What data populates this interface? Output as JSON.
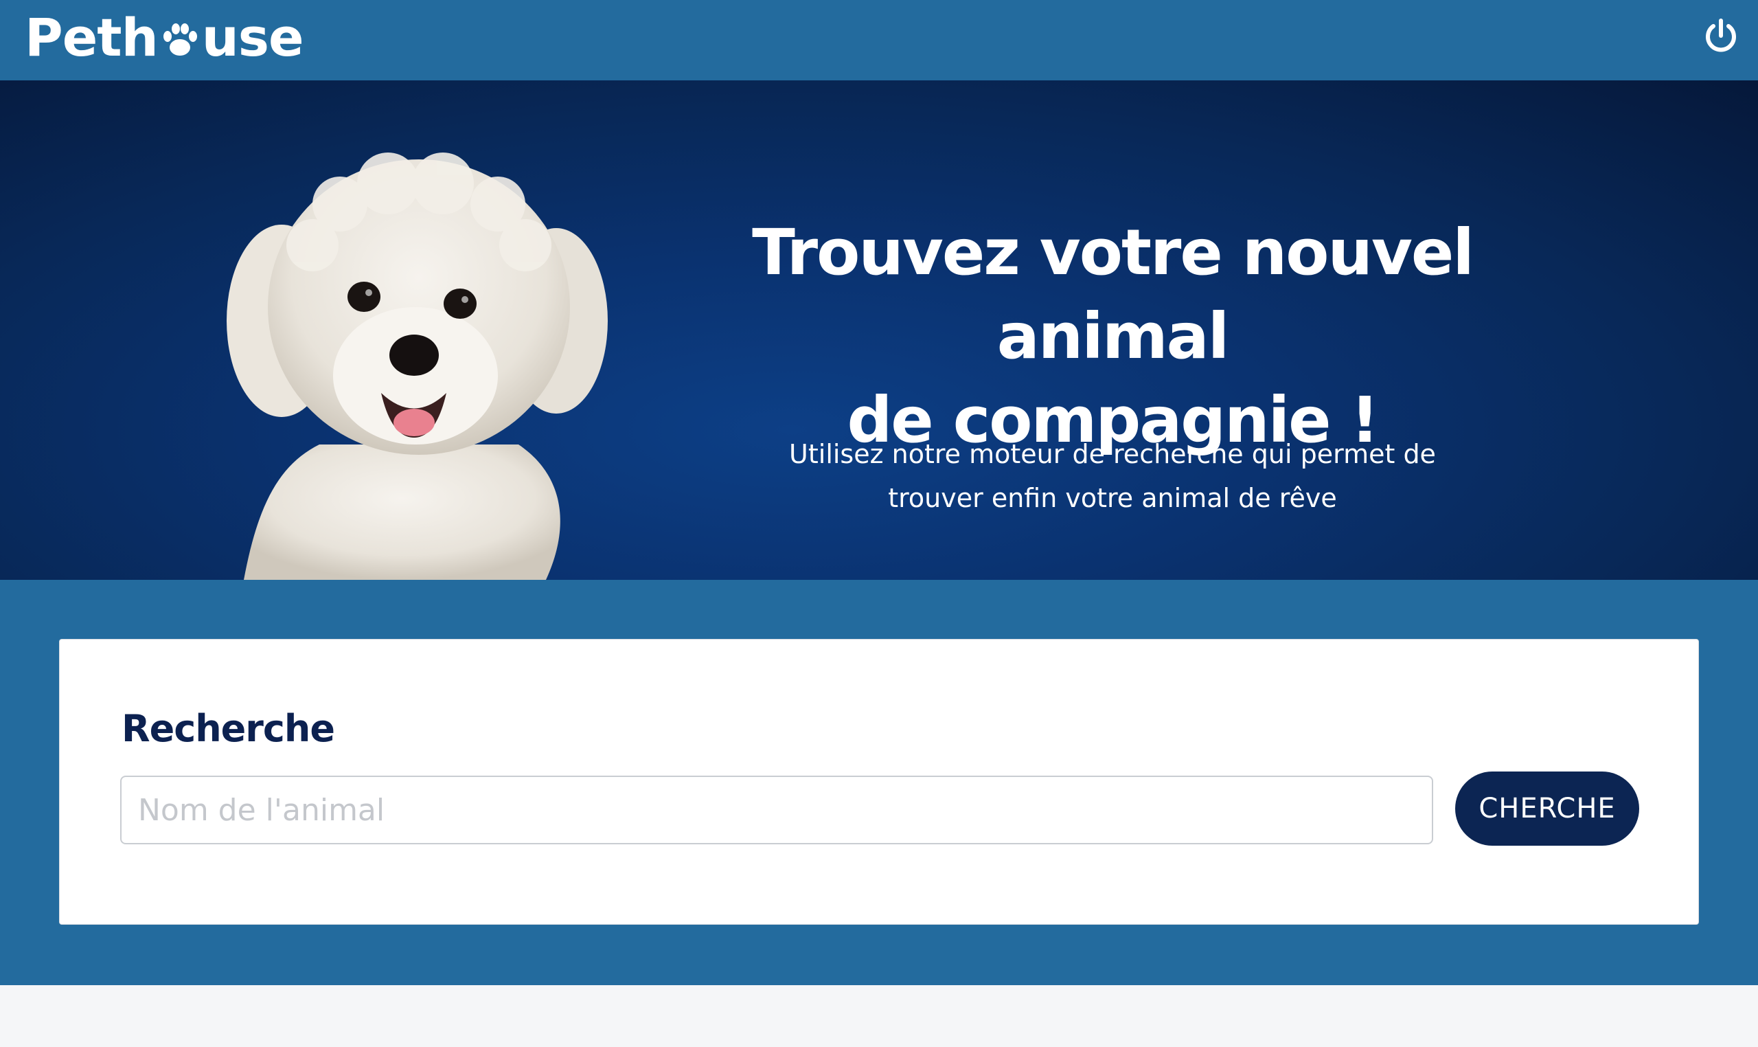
{
  "header": {
    "logo_prefix": "Peth",
    "logo_suffix": "use",
    "logo_icon": "paw-icon",
    "power_icon": "power-icon"
  },
  "hero": {
    "title_line1": "Trouvez votre nouvel animal",
    "title_line2": "de compagnie !",
    "subtitle_line1": "Utilisez notre moteur de recherche qui permet de",
    "subtitle_line2": "trouver enfin votre animal de rêve"
  },
  "search": {
    "title": "Recherche",
    "placeholder": "Nom de l'animal",
    "value": "",
    "button_label": "CHERCHE"
  },
  "colors": {
    "header_bg": "#236b9e",
    "hero_bg": "#0a3270",
    "button_bg": "#0c2553",
    "heading_color": "#0c2150"
  }
}
